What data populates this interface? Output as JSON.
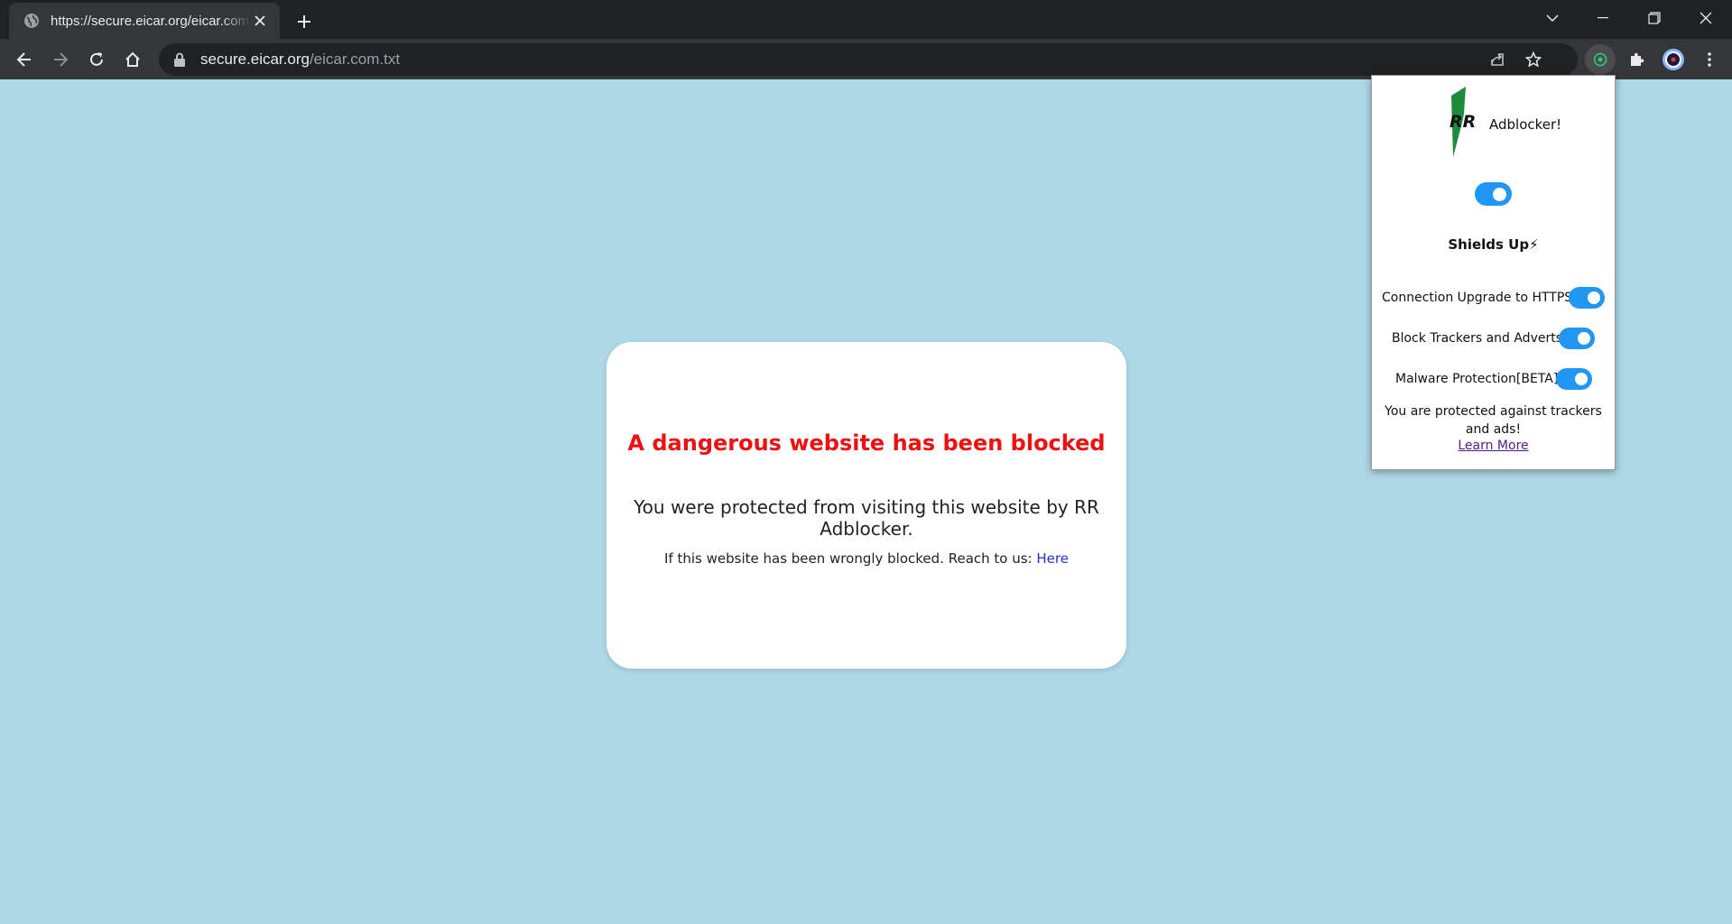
{
  "browser": {
    "tab_title": "https://secure.eicar.org/eicar.com.txt",
    "url_host": "secure.eicar.org",
    "url_path": "/eicar.com.txt"
  },
  "page": {
    "title": "A dangerous website has been blocked",
    "message": "You were protected from visiting this website by RR Adblocker.",
    "contact_text": "If this website has been wrongly blocked. Reach to us:",
    "contact_link": "Here",
    "background_color": "#add8e6",
    "title_color": "#ee1111"
  },
  "popup": {
    "name": "Adblocker!",
    "logo_text": "RR",
    "master_toggle_on": true,
    "status": "Shields Up⚡",
    "options": [
      {
        "label": "Connection Upgrade to HTTPS",
        "on": true
      },
      {
        "label": "Block Trackers and Adverts",
        "on": true
      },
      {
        "label": "Malware Protection[BETA]",
        "on": true
      }
    ],
    "protected_text": "You are protected against trackers and ads!",
    "learn_more": "Learn More",
    "accent_color": "#2196f3"
  },
  "icons": {
    "tab_favicon": "globe-icon",
    "tab_close": "close-icon",
    "new_tab": "plus-icon",
    "back": "arrow-left-icon",
    "forward": "arrow-right-icon",
    "reload": "reload-icon",
    "home": "home-icon",
    "lock": "lock-icon",
    "share": "share-icon",
    "bookmark": "star-icon",
    "extension_active": "adblocker-extension-icon",
    "extensions": "puzzle-icon",
    "profile": "profile-avatar-icon",
    "menu": "kebab-menu-icon"
  }
}
